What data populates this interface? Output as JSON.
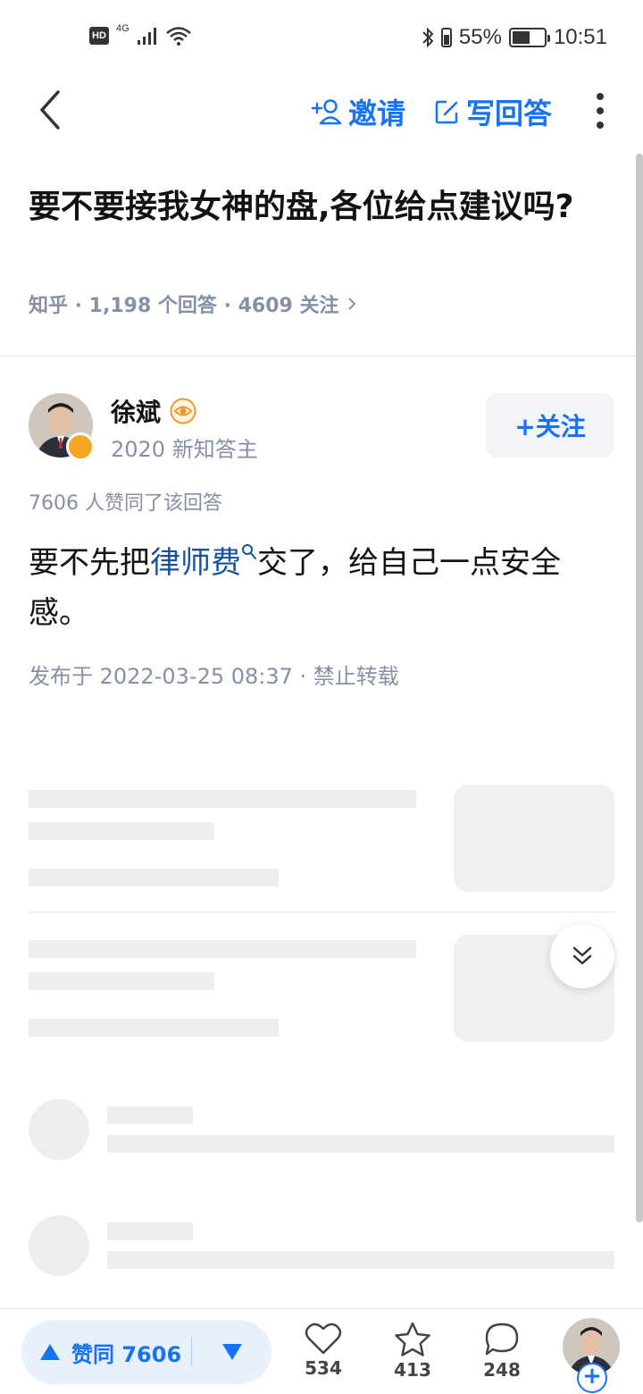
{
  "status_bar": {
    "hd": "HD",
    "network": "4G",
    "battery_percent": "55%",
    "battery_level": 0.55,
    "time": "10:51"
  },
  "nav": {
    "invite_label": "邀请",
    "write_label": "写回答"
  },
  "question": {
    "title": "要不要接我女神的盘,各位给点建议吗?",
    "meta": "知乎 · 1,198 个回答 · 4609 关注"
  },
  "author": {
    "name": "徐斌",
    "subtitle": "2020 新知答主",
    "follow_label": "+关注"
  },
  "answer": {
    "vote_summary": "7606 人赞同了该回答",
    "text_before": "要不先把",
    "link_text": "律师费",
    "text_after": "交了，给自己一点安全感。",
    "published": "发布于 2022-03-25 08:37 · 禁止转载"
  },
  "bottom_bar": {
    "upvote_label": "赞同 7606",
    "like_count": "534",
    "favorite_count": "413",
    "comment_count": "248",
    "plus": "+"
  },
  "colors": {
    "accent": "#1772f6",
    "meta_gray": "#8590a6",
    "link": "#175199"
  },
  "icons": {
    "back": "chevron-left-icon",
    "invite": "add-user-icon",
    "write": "edit-icon",
    "more": "more-vertical-icon",
    "vote_up": "triangle-up-icon",
    "vote_down": "triangle-down-icon",
    "like": "heart-icon",
    "favorite": "star-icon",
    "comment": "comment-bubble-icon",
    "scroll_down": "double-chevron-down-icon"
  }
}
